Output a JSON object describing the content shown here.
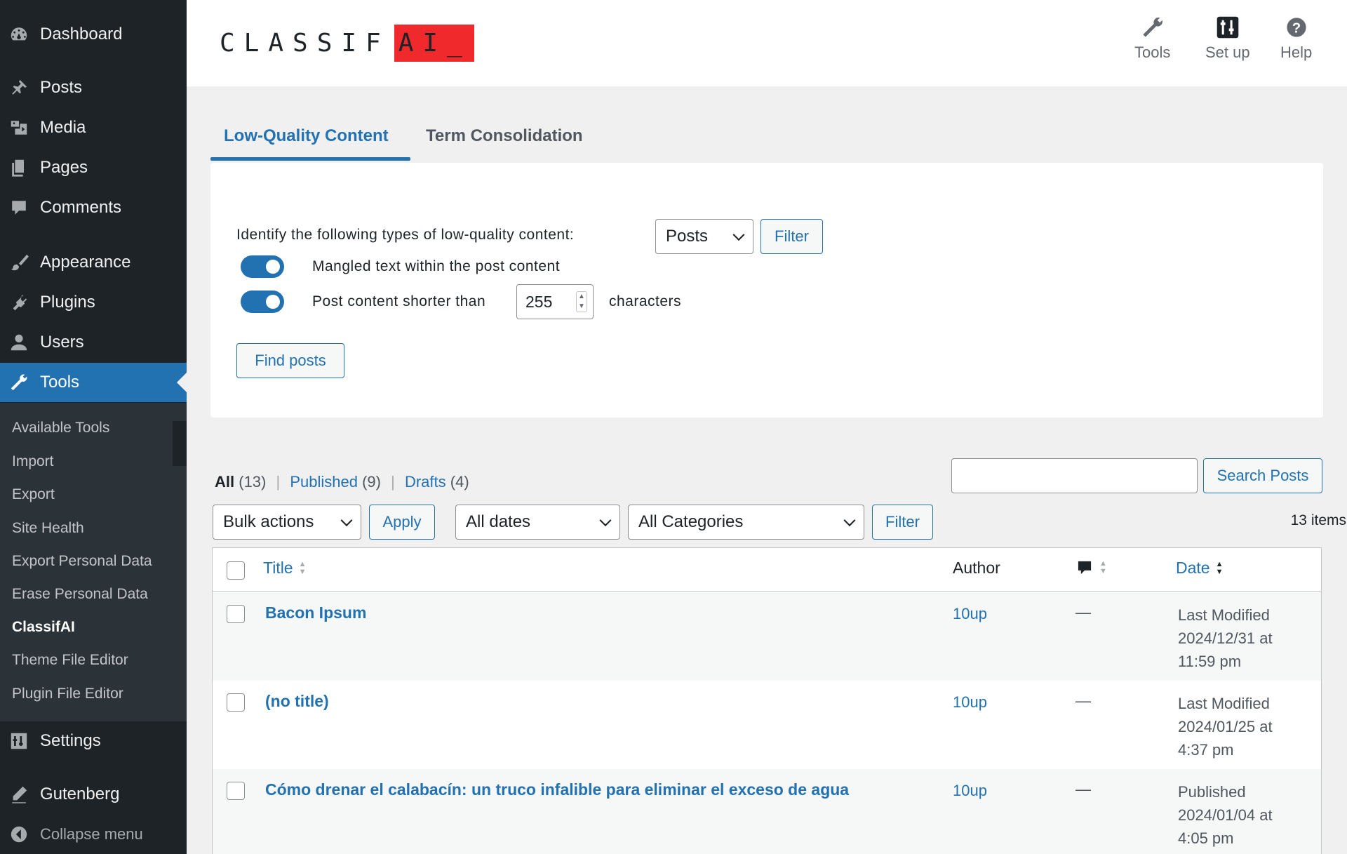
{
  "sidebar": {
    "menu": [
      {
        "label": "Dashboard",
        "icon": "dashboard-icon"
      },
      {
        "label": "Posts",
        "icon": "pin-icon"
      },
      {
        "label": "Media",
        "icon": "media-icon"
      },
      {
        "label": "Pages",
        "icon": "pages-icon"
      },
      {
        "label": "Comments",
        "icon": "comment-icon"
      },
      {
        "label": "Appearance",
        "icon": "brush-icon"
      },
      {
        "label": "Plugins",
        "icon": "plug-icon"
      },
      {
        "label": "Users",
        "icon": "user-icon"
      },
      {
        "label": "Tools",
        "icon": "wrench-icon"
      },
      {
        "label": "Settings",
        "icon": "settings-sliders-icon"
      },
      {
        "label": "Gutenberg",
        "icon": "pencil-icon"
      },
      {
        "label": "Collapse menu",
        "icon": "collapse-arrow-icon"
      }
    ],
    "submenu": [
      "Available Tools",
      "Import",
      "Export",
      "Site Health",
      "Export Personal Data",
      "Erase Personal Data",
      "ClassifAI",
      "Theme File Editor",
      "Plugin File Editor"
    ]
  },
  "header": {
    "logo_text": "CLASSIF",
    "logo_accent": "AI_",
    "buttons": [
      {
        "label": "Tools",
        "icon": "wrench-icon"
      },
      {
        "label": "Set up",
        "icon": "sliders-icon"
      },
      {
        "label": "Help",
        "icon": "help-icon"
      }
    ]
  },
  "tabs": [
    "Low-Quality Content",
    "Term Consolidation"
  ],
  "panel": {
    "identify_label": "Identify the following types of low-quality content:",
    "post_type_selected": "Posts",
    "filter_label": "Filter",
    "toggle1_label": "Mangled text within the post content",
    "toggle2_label": "Post content shorter than",
    "char_count": "255",
    "characters_label": "characters",
    "find_posts_label": "Find posts"
  },
  "list": {
    "views": {
      "all_label": "All",
      "all_count": "(13)",
      "published_label": "Published",
      "published_count": "(9)",
      "drafts_label": "Drafts",
      "drafts_count": "(4)",
      "separator": "|"
    },
    "search_button": "Search Posts",
    "search_value": "",
    "bulk_actions": "Bulk actions",
    "apply_label": "Apply",
    "dates": "All dates",
    "categories": "All Categories",
    "filter_label": "Filter",
    "items_count": "13 items"
  },
  "table": {
    "columns": {
      "title": "Title",
      "author": "Author",
      "date": "Date"
    },
    "rows": [
      {
        "title": "Bacon Ipsum",
        "author": "10up",
        "comments": "—",
        "date_line1": "Last Modified",
        "date_line2": "2024/12/31 at",
        "date_line3": "11:59 pm"
      },
      {
        "title": "(no title)",
        "author": "10up",
        "comments": "—",
        "date_line1": "Last Modified",
        "date_line2": "2024/01/25 at",
        "date_line3": "4:37 pm"
      },
      {
        "title": "Cómo drenar el calabacín: un truco infalible para eliminar el exceso de agua",
        "author": "10up",
        "comments": "—",
        "date_line1": "Published",
        "date_line2": "2024/01/04 at",
        "date_line3": "4:05 pm"
      }
    ]
  },
  "colors": {
    "sidebar_bg": "#1d2327",
    "submenu_bg": "#2c3338",
    "accent": "#2271b1",
    "logo_red": "#f0292c",
    "page_bg": "#f0f0f1"
  }
}
